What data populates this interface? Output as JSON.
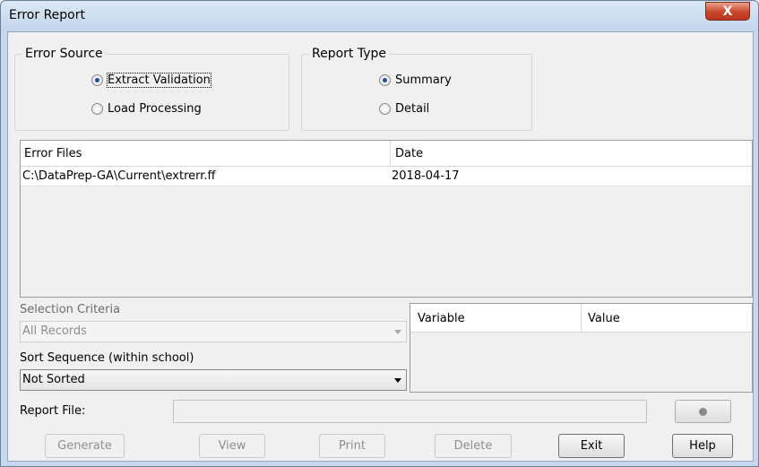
{
  "window": {
    "title": "Error Report",
    "close_glyph": "X"
  },
  "error_source": {
    "title": "Error Source",
    "options": [
      {
        "label": "Extract Validation",
        "checked": true
      },
      {
        "label": "Load Processing",
        "checked": false
      }
    ]
  },
  "report_type": {
    "title": "Report Type",
    "options": [
      {
        "label": "Summary",
        "checked": true
      },
      {
        "label": "Detail",
        "checked": false
      }
    ]
  },
  "error_files": {
    "columns": [
      "Error Files",
      "Date"
    ],
    "rows": [
      {
        "file": "C:\\DataPrep-GA\\Current\\extrerr.ff",
        "date": "2018-04-17"
      }
    ]
  },
  "selection_criteria": {
    "label": "Selection Criteria",
    "value": "All Records"
  },
  "sort_sequence": {
    "label": "Sort Sequence (within school)",
    "value": "Not Sorted"
  },
  "variables_table": {
    "columns": [
      "Variable",
      "Value"
    ]
  },
  "report_file": {
    "label": "Report File:",
    "value": ""
  },
  "buttons": {
    "generate": "Generate",
    "view": "View",
    "print": "Print",
    "delete": "Delete",
    "exit": "Exit",
    "help": "Help"
  }
}
